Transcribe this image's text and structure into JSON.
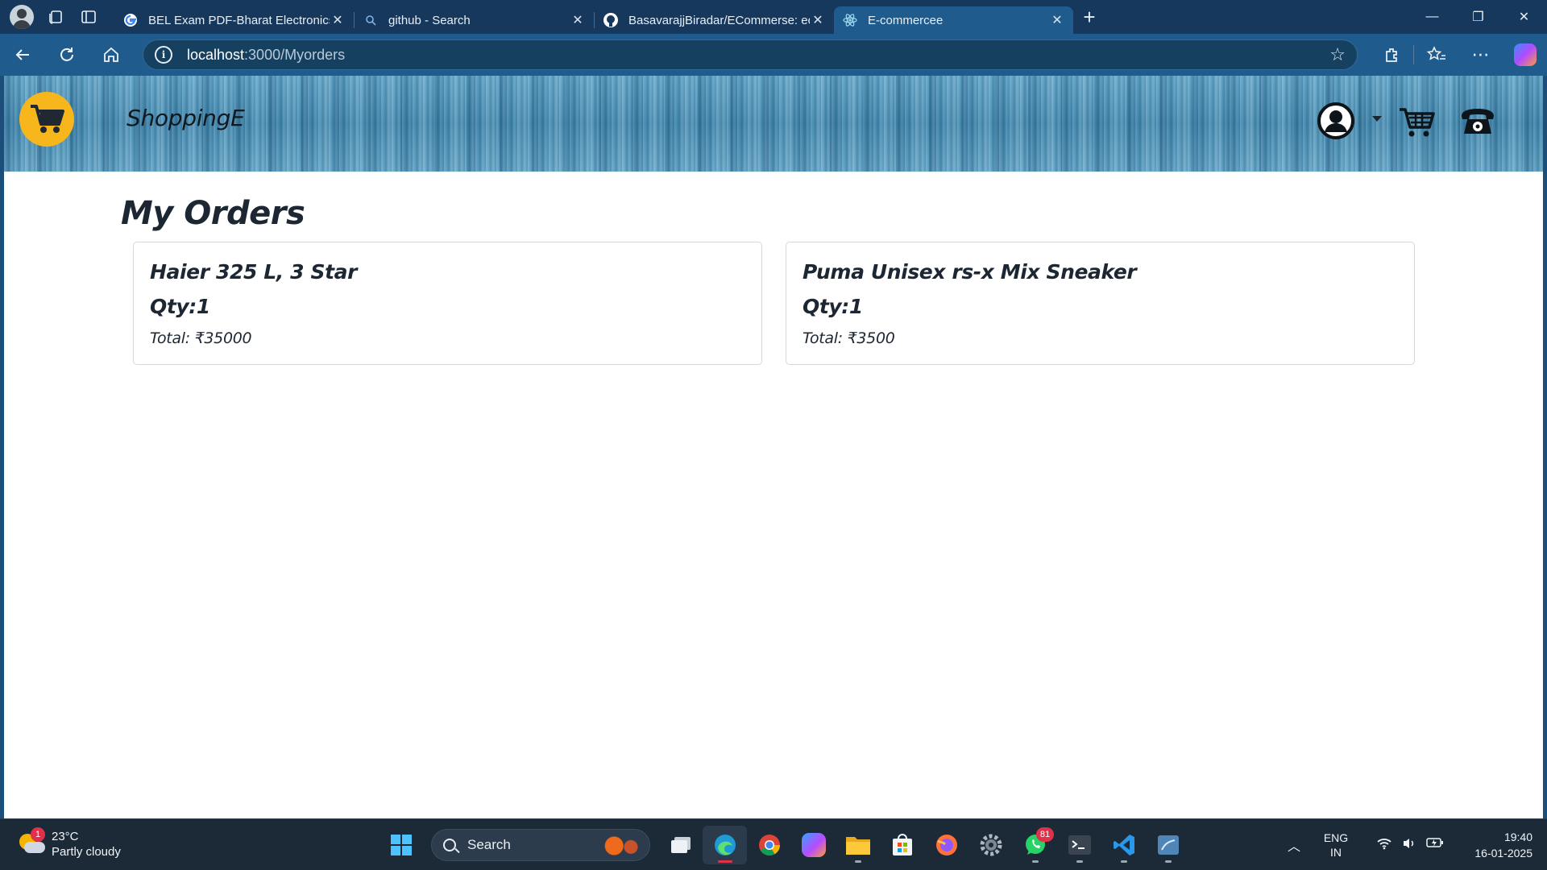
{
  "browser": {
    "tabs": [
      {
        "title": "BEL Exam PDF-Bharat Electronics",
        "favicon": "google-icon"
      },
      {
        "title": "github - Search",
        "favicon": "search-icon"
      },
      {
        "title": "BasavarajjBiradar/ECommerse: ec",
        "favicon": "github-icon"
      },
      {
        "title": "E-commercee",
        "favicon": "react-icon",
        "active": true
      }
    ],
    "url_host": "localhost",
    "url_path": ":3000/Myorders"
  },
  "site": {
    "brand": "ShoppingE",
    "header_icons": [
      "user-icon",
      "cart-icon",
      "phone-icon"
    ]
  },
  "page": {
    "title": "My Orders",
    "orders": [
      {
        "name": "Haier 325 L, 3 Star",
        "qty": "Qty:1",
        "total": "Total: ₹35000"
      },
      {
        "name": "Puma Unisex rs-x Mix Sneaker",
        "qty": "Qty:1",
        "total": "Total: ₹3500"
      }
    ]
  },
  "taskbar": {
    "weather_temp": "23°C",
    "weather_desc": "Partly cloudy",
    "weather_badge": "1",
    "search_label": "Search",
    "whatsapp_badge": "81",
    "lang_1": "ENG",
    "lang_2": "IN",
    "time": "19:40",
    "date": "16-01-2025"
  },
  "colors": {
    "browser_frame": "#16385c",
    "toolbar": "#1f5b8d",
    "logo_yellow": "#f6b61c",
    "header_blue": "#4f93b8"
  }
}
